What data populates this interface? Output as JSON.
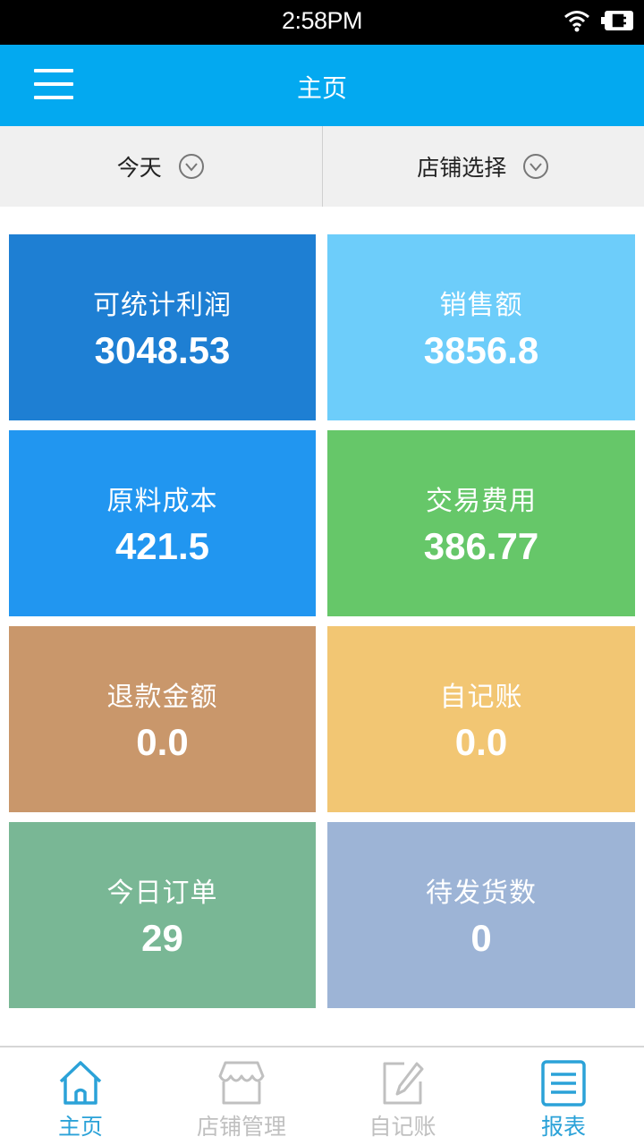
{
  "status_bar": {
    "time": "2:58PM",
    "icons": [
      "wifi-icon",
      "battery-icon"
    ]
  },
  "app_bar": {
    "title": "主页",
    "menu_icon": "hamburger-menu-icon"
  },
  "filters": [
    {
      "label": "今天",
      "icon": "chevron-down-circle-icon"
    },
    {
      "label": "店铺选择",
      "icon": "chevron-down-circle-icon"
    }
  ],
  "tiles": [
    {
      "label": "可统计利润",
      "value": "3048.53",
      "color": "#1e7fd3"
    },
    {
      "label": "销售额",
      "value": "3856.8",
      "color": "#6dcdfa"
    },
    {
      "label": "原料成本",
      "value": "421.5",
      "color": "#2196f0"
    },
    {
      "label": "交易费用",
      "value": "386.77",
      "color": "#66c769"
    },
    {
      "label": "退款金额",
      "value": "0.0",
      "color": "#c9976b"
    },
    {
      "label": "自记账",
      "value": "0.0",
      "color": "#f2c673"
    },
    {
      "label": "今日订单",
      "value": "29",
      "color": "#79b795"
    },
    {
      "label": "待发货数",
      "value": "0",
      "color": "#9db4d6"
    }
  ],
  "tab_bar": {
    "active_color": "#2ba2d8",
    "inactive_color": "#c0c0c0",
    "items": [
      {
        "label": "主页",
        "icon": "home-icon",
        "active": true
      },
      {
        "label": "店铺管理",
        "icon": "store-icon",
        "active": false
      },
      {
        "label": "自记账",
        "icon": "edit-icon",
        "active": false
      },
      {
        "label": "报表",
        "icon": "report-list-icon",
        "active": true
      }
    ]
  }
}
